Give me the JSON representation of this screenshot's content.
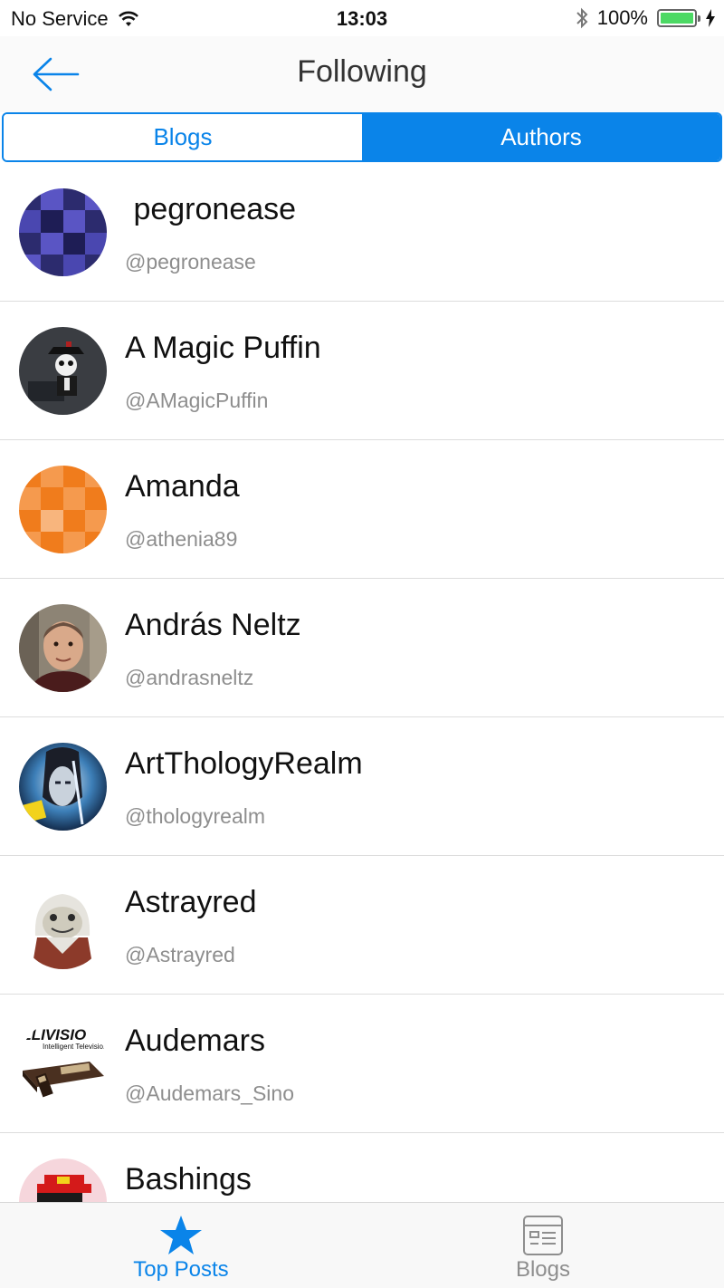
{
  "status_bar": {
    "carrier": "No Service",
    "time": "13:03",
    "battery_percent": "100%",
    "battery_level": 1.0
  },
  "nav": {
    "title": "Following",
    "back_icon": "arrow-left-icon"
  },
  "segments": {
    "blogs": "Blogs",
    "authors": "Authors",
    "selected": "Authors"
  },
  "authors": [
    {
      "name": " pegronease",
      "handle": "@pegronease"
    },
    {
      "name": "A Magic Puffin",
      "handle": "@AMagicPuffin"
    },
    {
      "name": "Amanda",
      "handle": "@athenia89"
    },
    {
      "name": "András Neltz",
      "handle": "@andrasneltz"
    },
    {
      "name": "ArtThologyRealm",
      "handle": "@thologyrealm"
    },
    {
      "name": "Astrayred",
      "handle": "@Astrayred"
    },
    {
      "name": "Audemars",
      "handle": "@Audemars_Sino"
    },
    {
      "name": "Bashings",
      "handle": ""
    }
  ],
  "avatar_art": {
    "intellivision_text": "ELLIVISIO",
    "intellivision_sub": "Intelligent Television"
  },
  "tabbar": {
    "top_posts": "Top Posts",
    "blogs": "Blogs"
  },
  "colors": {
    "accent": "#0a84e9",
    "secondary_text": "#8e8e8e",
    "battery": "#4cd964"
  }
}
